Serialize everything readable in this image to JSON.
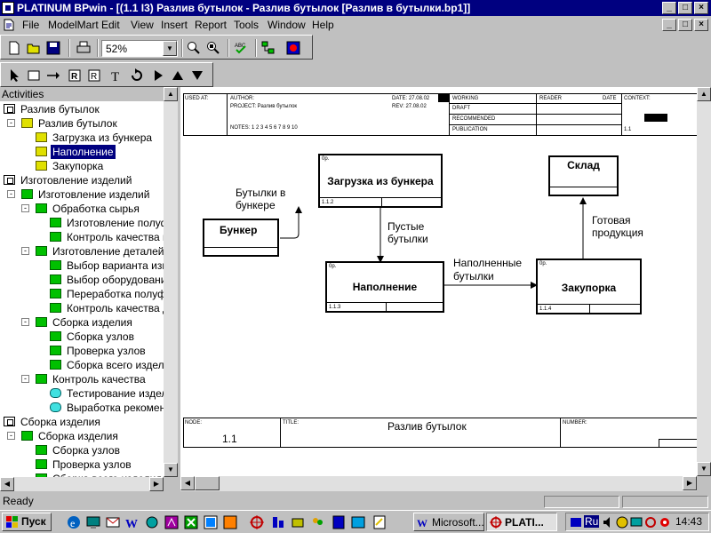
{
  "window": {
    "title": "PLATINUM BPwin - [(1.1 I3) Разлив бутылок - Разлив бутылок  [Разлив в бутылки.bp1]]",
    "title_buttons": [
      "_",
      "□",
      "×"
    ],
    "doc_buttons": [
      "_",
      "□",
      "×"
    ]
  },
  "menu": {
    "items": [
      "File",
      "ModelMart",
      "Edit",
      "View",
      "Insert",
      "Report",
      "Tools",
      "Window",
      "Help"
    ]
  },
  "toolbar": {
    "zoom_value": "52%",
    "buttons": [
      "new-icon",
      "open-icon",
      "save-icon",
      "print-icon",
      "zoom-icon",
      "zoom-fit-icon",
      "spellcheck-icon",
      "model-explorer-icon",
      "color-icon"
    ],
    "tools": [
      "pointer-icon",
      "box-tool-icon",
      "arrow-tool-icon",
      "referent-icon",
      "undo-icon",
      "text-icon",
      "squiggle-icon",
      "forward-icon",
      "up-icon",
      "down-icon"
    ]
  },
  "activities": {
    "header": "Activities",
    "items": [
      {
        "label": "Разлив бутылок",
        "level": 0,
        "icon": "root",
        "expand": ""
      },
      {
        "label": "Разлив бутылок",
        "level": 1,
        "icon": "yellow",
        "expand": "-"
      },
      {
        "label": "Загрузка из бункера",
        "level": 2,
        "icon": "yellow",
        "expand": ""
      },
      {
        "label": "Наполнение",
        "level": 2,
        "icon": "yellow",
        "expand": "",
        "selected": true
      },
      {
        "label": "Закупорка",
        "level": 2,
        "icon": "yellow",
        "expand": ""
      },
      {
        "label": "Изготовление изделий",
        "level": 0,
        "icon": "root",
        "expand": ""
      },
      {
        "label": "Изготовление изделий",
        "level": 1,
        "icon": "green",
        "expand": "-"
      },
      {
        "label": "Обработка  сырья",
        "level": 2,
        "icon": "green",
        "expand": "-"
      },
      {
        "label": "Изготовление полуф",
        "level": 3,
        "icon": "green",
        "expand": ""
      },
      {
        "label": "Контроль качества п",
        "level": 3,
        "icon": "green",
        "expand": ""
      },
      {
        "label": "Изготовление  деталей",
        "level": 2,
        "icon": "green",
        "expand": "-"
      },
      {
        "label": "Выбор  варианта изг",
        "level": 3,
        "icon": "green",
        "expand": ""
      },
      {
        "label": "Выбор оборудования",
        "level": 3,
        "icon": "green",
        "expand": ""
      },
      {
        "label": "Переработка полуфа",
        "level": 3,
        "icon": "green",
        "expand": ""
      },
      {
        "label": "Контроль качества д",
        "level": 3,
        "icon": "green",
        "expand": ""
      },
      {
        "label": "Сборка изделия",
        "level": 2,
        "icon": "green",
        "expand": "-"
      },
      {
        "label": "Сборка узлов",
        "level": 3,
        "icon": "green",
        "expand": ""
      },
      {
        "label": "Проверка узлов",
        "level": 3,
        "icon": "green",
        "expand": ""
      },
      {
        "label": "Сборка всего издели",
        "level": 3,
        "icon": "green",
        "expand": ""
      },
      {
        "label": "Контроль качества",
        "level": 2,
        "icon": "green",
        "expand": "-"
      },
      {
        "label": "Тестирование издели",
        "level": 3,
        "icon": "cyan",
        "expand": ""
      },
      {
        "label": "Выработка рекоменд",
        "level": 3,
        "icon": "cyan",
        "expand": ""
      },
      {
        "label": "Сборка изделия",
        "level": 0,
        "icon": "root",
        "expand": ""
      },
      {
        "label": "Сборка изделия",
        "level": 1,
        "icon": "green",
        "expand": "-"
      },
      {
        "label": "Сборка узлов",
        "level": 2,
        "icon": "green",
        "expand": ""
      },
      {
        "label": "Проверка узлов",
        "level": 2,
        "icon": "green",
        "expand": ""
      },
      {
        "label": "Сборка всего изделия",
        "level": 2,
        "icon": "green",
        "expand": ""
      }
    ]
  },
  "diagram": {
    "header": {
      "used_at": "USED AT:",
      "author": "AUTHOR:",
      "project": "PROJECT:  Разлив бутылок",
      "date": "DATE:  27.08.02",
      "rev": "REV:  27.08.02",
      "notes": "NOTES:  1  2  3  4  5  6  7  8  9  10",
      "working": "WORKING",
      "draft": "DRAFT",
      "recommended": "RECOMMENDED",
      "publication": "PUBLICATION",
      "reader": "READER",
      "reader_date": "DATE",
      "context": "CONTEXT:",
      "context_num": "1.1"
    },
    "boxes": {
      "bunker": {
        "name": "Бункер"
      },
      "loading": {
        "name": "Загрузка из бункера",
        "ref": "0р.",
        "num": "1.1.2"
      },
      "filling": {
        "name": "Наполнение",
        "ref": "0р.",
        "num": "1.1.3"
      },
      "capping": {
        "name": "Закупорка",
        "ref": "0р.",
        "num": "1.1.4"
      },
      "warehouse": {
        "name": "Склад"
      }
    },
    "labels": {
      "bottles_in_bunker_1": "Бутылки в",
      "bottles_in_bunker_2": "бункере",
      "empty_bottles_1": "Пустые",
      "empty_bottles_2": "бутылки",
      "filled_bottles_1": "Наполненные",
      "filled_bottles_2": "бутылки",
      "finished_product_1": "Готовая",
      "finished_product_2": "продукция"
    },
    "footer": {
      "node": "NODE:",
      "node_value": "1.1",
      "title": "TITLE:",
      "title_value": "Разлив бутылок",
      "number": "NUMBER:"
    }
  },
  "status": {
    "text": "Ready"
  },
  "taskbar": {
    "start_label": "Пуск",
    "tasks": [
      {
        "label": "Microsoft..."
      },
      {
        "label": "PLATI..."
      }
    ],
    "tray_lang": "Ru",
    "clock": "14:43"
  }
}
